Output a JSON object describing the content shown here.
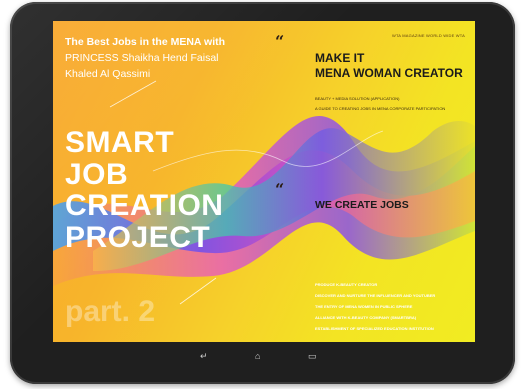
{
  "header": {
    "line1": "The Best Jobs in the MENA with",
    "line2": "PRINCESS Shaikha Hend Faisal",
    "line3": "Khaled Al Qassimi"
  },
  "magazine": "WTA MAGAZINE WORLD WIDE WTA",
  "make_it": {
    "line1": "MAKE IT",
    "line2": "MENA WOMAN CREATOR"
  },
  "make_it_sub": [
    "BEAUTY + MEDIA SOLUTION (APPLICATION)",
    "A GUIDE TO CREATING JOBS IN MENA CORPORATE PARTICIPATION"
  ],
  "we_create": "WE CREATE JOBS",
  "big_title": [
    "SMART",
    "JOB",
    "CREATION",
    "PROJECT"
  ],
  "part": "part. 2",
  "bottom_list": [
    "PRODUCE K-BEAUTY CREATOR",
    "DISCOVER AND NURTURE THE INFLUENCER AND YOUTUBER",
    "THE ENTRY OF MENA WOMEN IN PUBLIC SPHERE",
    "ALLIANCE WITH K-BEAUTY COMPANY (SMARTBRA)",
    "ESTABLISHMENT OF SPECIALIZED EDUCATION INSTITUTION"
  ],
  "quote_mark": "“",
  "tablet_buttons": {
    "back": "↵",
    "home": "⌂",
    "menu": "▭"
  },
  "colors": {
    "background_start": "#f9a72b",
    "background_end": "#f1ec22",
    "wave_purple": "#7a4be0",
    "wave_teal": "#39c6b0",
    "wave_magenta": "#d94dbf"
  }
}
